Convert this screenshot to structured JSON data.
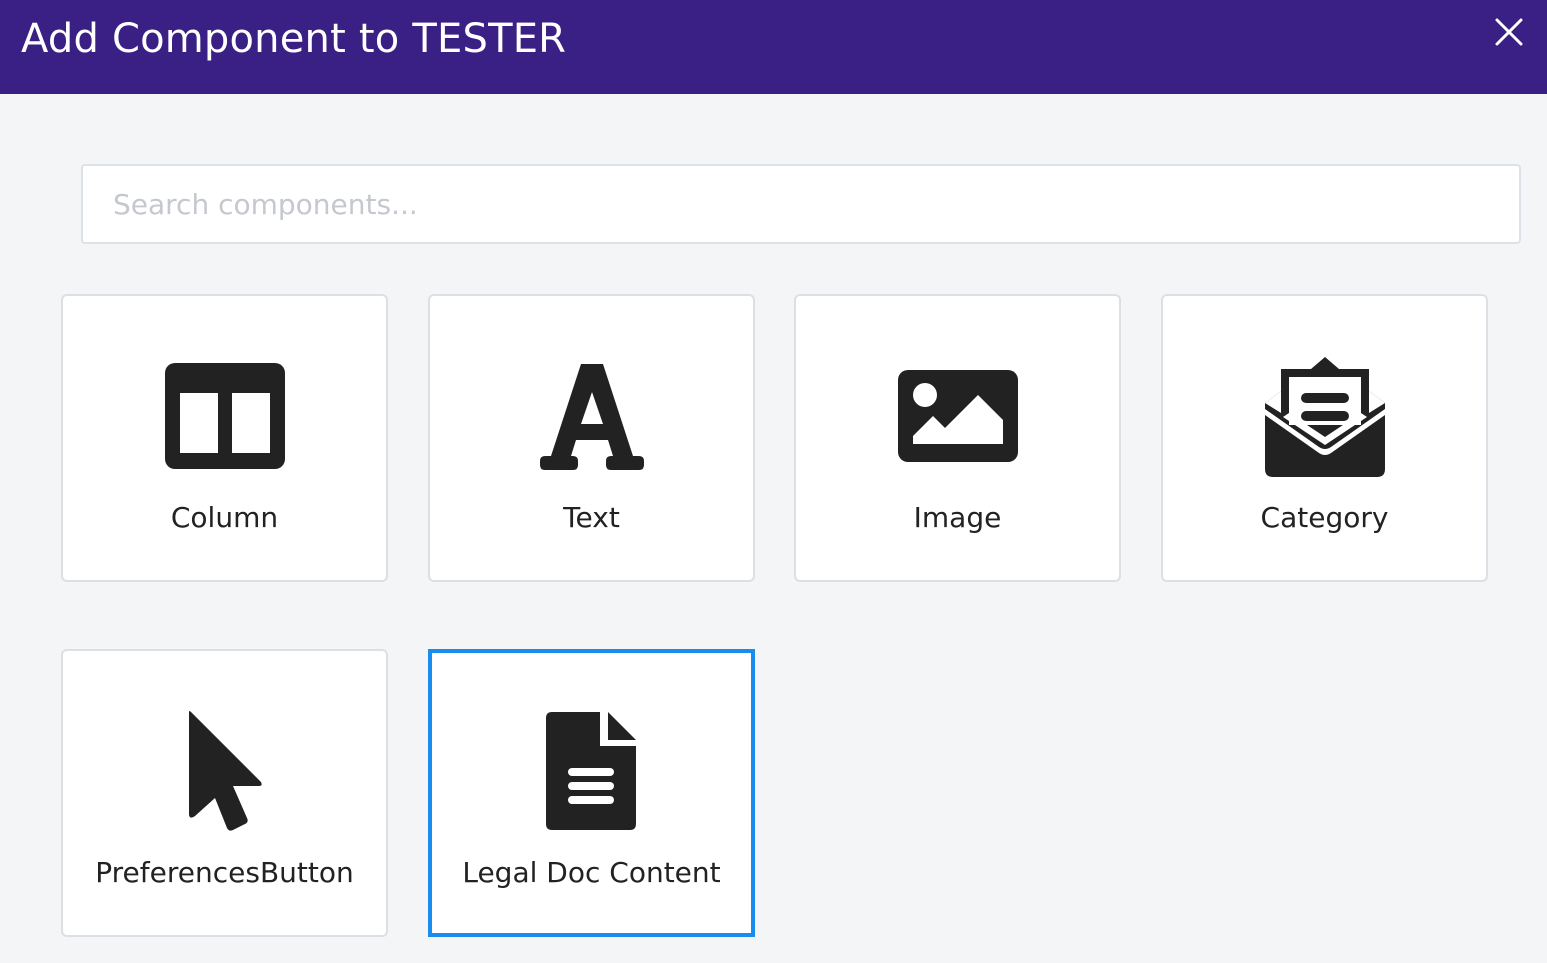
{
  "dialog": {
    "title": "Add Component to TESTER",
    "close_icon": "close-icon",
    "header_color": "#3a1f84"
  },
  "search": {
    "placeholder": "Search components...",
    "value": ""
  },
  "components": [
    {
      "label": "Column",
      "icon": "columns-icon"
    },
    {
      "label": "Text",
      "icon": "text-font-icon"
    },
    {
      "label": "Image",
      "icon": "image-icon"
    },
    {
      "label": "Category",
      "icon": "envelope-open-text-icon"
    },
    {
      "label": "PreferencesButton",
      "icon": "mouse-pointer-icon"
    },
    {
      "label": "Legal Doc Content",
      "icon": "file-alt-icon",
      "selected": true
    }
  ],
  "colors": {
    "accent": "#1a8cf0",
    "icon": "#222222"
  }
}
